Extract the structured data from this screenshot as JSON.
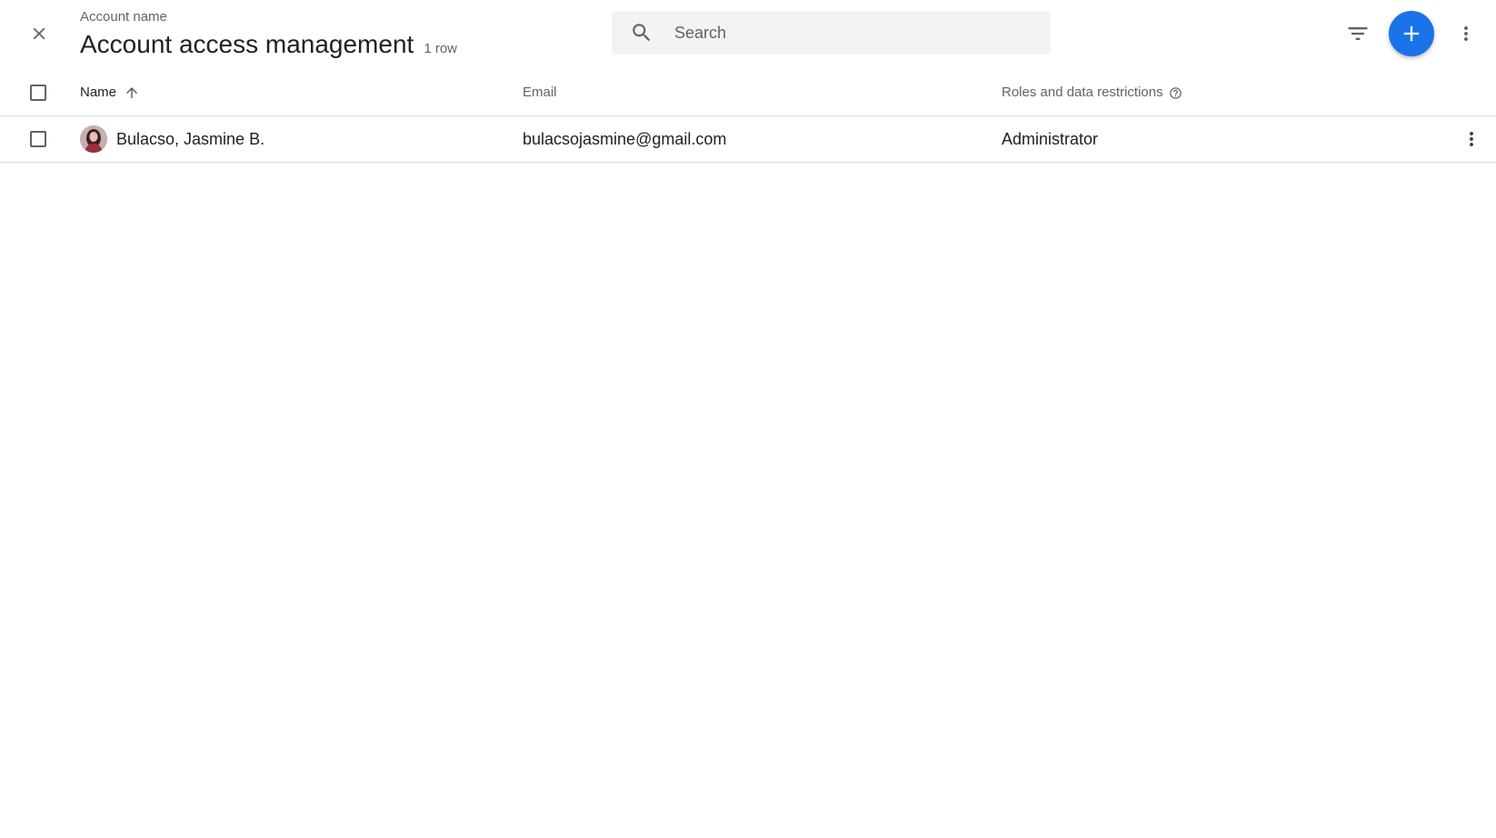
{
  "header": {
    "account_label": "Account name",
    "title": "Account access management",
    "row_count": "1 row",
    "close_icon": "close-icon",
    "filter_icon": "filter-icon",
    "add_icon": "plus-icon",
    "more_icon": "more-vert-icon"
  },
  "search": {
    "placeholder": "Search",
    "value": ""
  },
  "table": {
    "columns": {
      "name": "Name",
      "email": "Email",
      "roles": "Roles and data restrictions"
    },
    "sort": {
      "column": "name",
      "direction": "ascending"
    },
    "rows": [
      {
        "name": "Bulacso, Jasmine B.",
        "email": "bulacsojasmine@gmail.com",
        "role": "Administrator"
      }
    ]
  },
  "colors": {
    "accent": "#1a73e8",
    "search_bg": "#f1f3f4",
    "divider": "#dadce0",
    "secondary_text": "#5f6368"
  }
}
